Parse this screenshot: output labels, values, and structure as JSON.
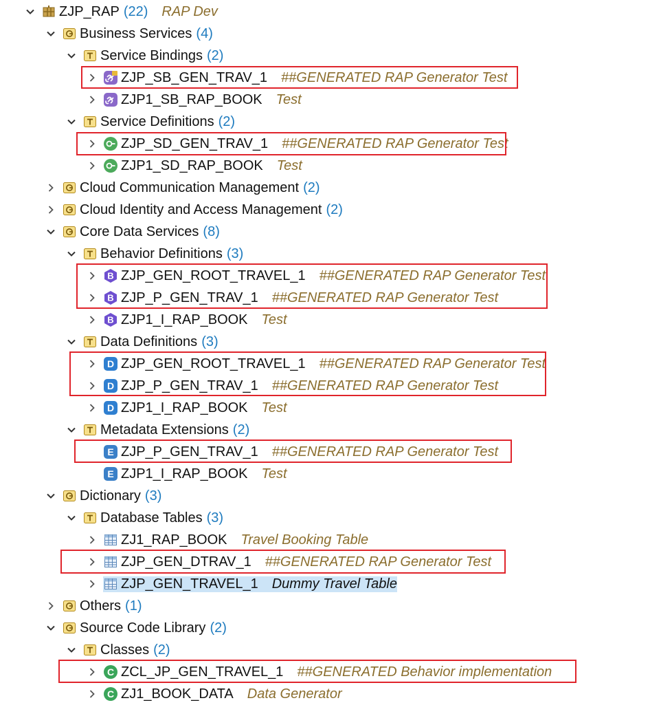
{
  "tree": [
    {
      "name": "ZJP_RAP",
      "count": "(22)",
      "desc": "RAP Dev",
      "icon": "package-icon",
      "chevron": "expanded",
      "selected": false
    },
    {
      "name": "Business Services",
      "count": "(4)",
      "desc": "",
      "icon": "group-folder-icon",
      "chevron": "expanded",
      "selected": false
    },
    {
      "name": "Service Bindings",
      "count": "(2)",
      "desc": "",
      "icon": "type-folder-icon",
      "chevron": "expanded",
      "selected": false
    },
    {
      "name": "ZJP_SB_GEN_TRAV_1",
      "count": "",
      "desc": "##GENERATED RAP Generator Test",
      "icon": "service-binding-locked-icon",
      "chevron": "collapsed",
      "selected": false
    },
    {
      "name": "ZJP1_SB_RAP_BOOK",
      "count": "",
      "desc": "Test",
      "icon": "service-binding-icon",
      "chevron": "collapsed",
      "selected": false
    },
    {
      "name": "Service Definitions",
      "count": "(2)",
      "desc": "",
      "icon": "type-folder-icon",
      "chevron": "expanded",
      "selected": false
    },
    {
      "name": "ZJP_SD_GEN_TRAV_1",
      "count": "",
      "desc": "##GENERATED RAP Generator Test",
      "icon": "service-definition-icon",
      "chevron": "collapsed",
      "selected": false
    },
    {
      "name": "ZJP1_SD_RAP_BOOK",
      "count": "",
      "desc": "Test",
      "icon": "service-definition-icon",
      "chevron": "collapsed",
      "selected": false
    },
    {
      "name": "Cloud Communication Management",
      "count": "(2)",
      "desc": "",
      "icon": "group-folder-icon",
      "chevron": "collapsed",
      "selected": false
    },
    {
      "name": "Cloud Identity and Access Management",
      "count": "(2)",
      "desc": "",
      "icon": "group-folder-icon",
      "chevron": "collapsed",
      "selected": false
    },
    {
      "name": "Core Data Services",
      "count": "(8)",
      "desc": "",
      "icon": "group-folder-icon",
      "chevron": "expanded",
      "selected": false
    },
    {
      "name": "Behavior Definitions",
      "count": "(3)",
      "desc": "",
      "icon": "type-folder-icon",
      "chevron": "expanded",
      "selected": false
    },
    {
      "name": "ZJP_GEN_ROOT_TRAVEL_1",
      "count": "",
      "desc": "##GENERATED RAP Generator Test",
      "icon": "behavior-definition-icon",
      "chevron": "collapsed",
      "selected": false
    },
    {
      "name": "ZJP_P_GEN_TRAV_1",
      "count": "",
      "desc": "##GENERATED RAP Generator Test",
      "icon": "behavior-definition-icon",
      "chevron": "collapsed",
      "selected": false
    },
    {
      "name": "ZJP1_I_RAP_BOOK",
      "count": "",
      "desc": "Test",
      "icon": "behavior-definition-icon",
      "chevron": "collapsed",
      "selected": false
    },
    {
      "name": "Data Definitions",
      "count": "(3)",
      "desc": "",
      "icon": "type-folder-icon",
      "chevron": "expanded",
      "selected": false
    },
    {
      "name": "ZJP_GEN_ROOT_TRAVEL_1",
      "count": "",
      "desc": "##GENERATED RAP Generator Test",
      "icon": "data-definition-icon",
      "chevron": "collapsed",
      "selected": false
    },
    {
      "name": "ZJP_P_GEN_TRAV_1",
      "count": "",
      "desc": "##GENERATED RAP Generator Test",
      "icon": "data-definition-icon",
      "chevron": "collapsed",
      "selected": false
    },
    {
      "name": "ZJP1_I_RAP_BOOK",
      "count": "",
      "desc": "Test",
      "icon": "data-definition-icon",
      "chevron": "collapsed",
      "selected": false
    },
    {
      "name": "Metadata Extensions",
      "count": "(2)",
      "desc": "",
      "icon": "type-folder-icon",
      "chevron": "expanded",
      "selected": false
    },
    {
      "name": "ZJP_P_GEN_TRAV_1",
      "count": "",
      "desc": "##GENERATED RAP Generator Test",
      "icon": "metadata-extension-icon",
      "chevron": "none",
      "selected": false
    },
    {
      "name": "ZJP1_I_RAP_BOOK",
      "count": "",
      "desc": "Test",
      "icon": "metadata-extension-icon",
      "chevron": "none",
      "selected": false
    },
    {
      "name": "Dictionary",
      "count": "(3)",
      "desc": "",
      "icon": "group-folder-icon",
      "chevron": "expanded",
      "selected": false
    },
    {
      "name": "Database Tables",
      "count": "(3)",
      "desc": "",
      "icon": "type-folder-icon",
      "chevron": "expanded",
      "selected": false
    },
    {
      "name": "ZJ1_RAP_BOOK",
      "count": "",
      "desc": "Travel Booking Table",
      "icon": "database-table-icon",
      "chevron": "collapsed",
      "selected": false
    },
    {
      "name": "ZJP_GEN_DTRAV_1",
      "count": "",
      "desc": "##GENERATED RAP Generator Test",
      "icon": "database-table-icon",
      "chevron": "collapsed",
      "selected": false
    },
    {
      "name": "ZJP_GEN_TRAVEL_1",
      "count": "",
      "desc": "Dummy Travel Table",
      "icon": "database-table-icon",
      "chevron": "collapsed",
      "selected": true
    },
    {
      "name": "Others",
      "count": "(1)",
      "desc": "",
      "icon": "group-folder-icon",
      "chevron": "collapsed",
      "selected": false
    },
    {
      "name": "Source Code Library",
      "count": "(2)",
      "desc": "",
      "icon": "group-folder-icon",
      "chevron": "expanded",
      "selected": false
    },
    {
      "name": "Classes",
      "count": "(2)",
      "desc": "",
      "icon": "type-folder-icon",
      "chevron": "expanded",
      "selected": false
    },
    {
      "name": "ZCL_JP_GEN_TRAVEL_1",
      "count": "",
      "desc": "##GENERATED Behavior implementation",
      "icon": "class-icon",
      "chevron": "collapsed",
      "selected": false
    },
    {
      "name": "ZJ1_BOOK_DATA",
      "count": "",
      "desc": "Data Generator",
      "icon": "class-icon",
      "chevron": "collapsed",
      "selected": false
    }
  ],
  "colors": {
    "count": "#1e7bbf",
    "description": "#8b6e2e",
    "highlight_box": "#e0242b",
    "selection": "#cce4f7"
  }
}
